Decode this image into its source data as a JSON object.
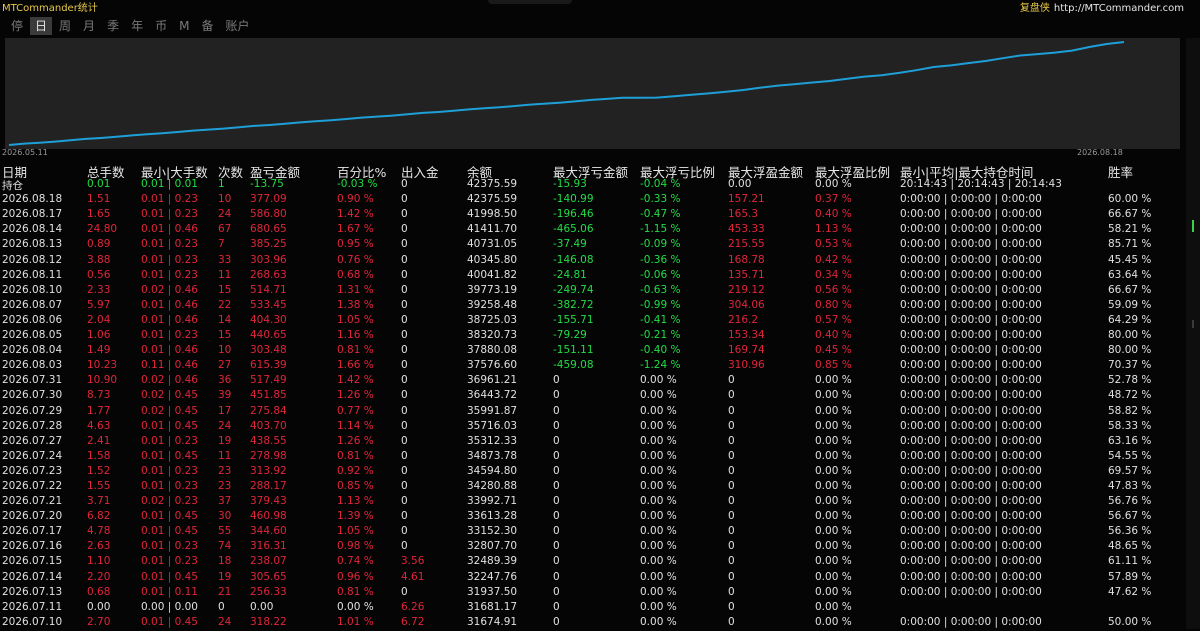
{
  "app": {
    "title": "MTCommander统计",
    "right_name": "复盘侠",
    "right_url": "http://MTCommander.com"
  },
  "tabs": [
    "停",
    "日",
    "周",
    "月",
    "季",
    "年",
    "币",
    "M",
    "备",
    "账户"
  ],
  "active_tab": "日",
  "chart_data": {
    "type": "line",
    "start_label": "2026.05.11",
    "end_label": "2026.08.18",
    "color": "#1e9fd8",
    "background": "#222222",
    "grid": false
  },
  "colors": {
    "profit": "#e0253a",
    "loss": "#22dd44",
    "text": "#e0e0e0",
    "accent": "#e8c84a"
  },
  "table": {
    "headers": [
      "日期",
      "总手数",
      "最小|大手数",
      "次数",
      "盈亏金额",
      "百分比%",
      "出入金",
      "余额",
      "最大浮亏金额",
      "最大浮亏比例",
      "最大浮盈金额",
      "最大浮盈比例",
      "最小|平均|最大持仓时间",
      "胜率"
    ],
    "rows": [
      [
        "持仓",
        "0.01",
        "0.01 | 0.01",
        "1",
        "-13.75",
        "-0.03 %",
        "0",
        "42375.59",
        "-15.93",
        "-0.04 %",
        "0.00",
        "0.00 %",
        "20:14:43 | 20:14:43 | 20:14:43",
        ""
      ],
      [
        "2026.08.18",
        "1.51",
        "0.01 | 0.23",
        "10",
        "377.09",
        "0.90 %",
        "0",
        "42375.59",
        "-140.99",
        "-0.33 %",
        "157.21",
        "0.37 %",
        "0:00:00 | 0:00:00 | 0:00:00",
        "60.00 %"
      ],
      [
        "2026.08.17",
        "1.65",
        "0.01 | 0.23",
        "24",
        "586.80",
        "1.42 %",
        "0",
        "41998.50",
        "-196.46",
        "-0.47 %",
        "165.3",
        "0.40 %",
        "0:00:00 | 0:00:00 | 0:00:00",
        "66.67 %"
      ],
      [
        "2026.08.14",
        "24.80",
        "0.01 | 0.46",
        "67",
        "680.65",
        "1.67 %",
        "0",
        "41411.70",
        "-465.06",
        "-1.15 %",
        "453.33",
        "1.13 %",
        "0:00:00 | 0:00:00 | 0:00:00",
        "58.21 %"
      ],
      [
        "2026.08.13",
        "0.89",
        "0.01 | 0.23",
        "7",
        "385.25",
        "0.95 %",
        "0",
        "40731.05",
        "-37.49",
        "-0.09 %",
        "215.55",
        "0.53 %",
        "0:00:00 | 0:00:00 | 0:00:00",
        "85.71 %"
      ],
      [
        "2026.08.12",
        "3.88",
        "0.01 | 0.23",
        "33",
        "303.96",
        "0.76 %",
        "0",
        "40345.80",
        "-146.08",
        "-0.36 %",
        "168.78",
        "0.42 %",
        "0:00:00 | 0:00:00 | 0:00:00",
        "45.45 %"
      ],
      [
        "2026.08.11",
        "0.56",
        "0.01 | 0.23",
        "11",
        "268.63",
        "0.68 %",
        "0",
        "40041.82",
        "-24.81",
        "-0.06 %",
        "135.71",
        "0.34 %",
        "0:00:00 | 0:00:00 | 0:00:00",
        "63.64 %"
      ],
      [
        "2026.08.10",
        "2.33",
        "0.02 | 0.46",
        "15",
        "514.71",
        "1.31 %",
        "0",
        "39773.19",
        "-249.74",
        "-0.63 %",
        "219.12",
        "0.56 %",
        "0:00:00 | 0:00:00 | 0:00:00",
        "66.67 %"
      ],
      [
        "2026.08.07",
        "5.97",
        "0.01 | 0.46",
        "22",
        "533.45",
        "1.38 %",
        "0",
        "39258.48",
        "-382.72",
        "-0.99 %",
        "304.06",
        "0.80 %",
        "0:00:00 | 0:00:00 | 0:00:00",
        "59.09 %"
      ],
      [
        "2026.08.06",
        "2.04",
        "0.01 | 0.46",
        "14",
        "404.30",
        "1.05 %",
        "0",
        "38725.03",
        "-155.71",
        "-0.41 %",
        "216.2",
        "0.57 %",
        "0:00:00 | 0:00:00 | 0:00:00",
        "64.29 %"
      ],
      [
        "2026.08.05",
        "1.06",
        "0.01 | 0.23",
        "15",
        "440.65",
        "1.16 %",
        "0",
        "38320.73",
        "-79.29",
        "-0.21 %",
        "153.34",
        "0.40 %",
        "0:00:00 | 0:00:00 | 0:00:00",
        "80.00 %"
      ],
      [
        "2026.08.04",
        "1.49",
        "0.01 | 0.46",
        "10",
        "303.48",
        "0.81 %",
        "0",
        "37880.08",
        "-151.11",
        "-0.40 %",
        "169.74",
        "0.45 %",
        "0:00:00 | 0:00:00 | 0:00:00",
        "80.00 %"
      ],
      [
        "2026.08.03",
        "10.23",
        "0.11 | 0.46",
        "27",
        "615.39",
        "1.66 %",
        "0",
        "37576.60",
        "-459.08",
        "-1.24 %",
        "310.96",
        "0.85 %",
        "0:00:00 | 0:00:00 | 0:00:00",
        "70.37 %"
      ],
      [
        "2026.07.31",
        "10.90",
        "0.02 | 0.46",
        "36",
        "517.49",
        "1.42 %",
        "0",
        "36961.21",
        "0",
        "0.00 %",
        "0",
        "0.00 %",
        "0:00:00 | 0:00:00 | 0:00:00",
        "52.78 %"
      ],
      [
        "2026.07.30",
        "8.73",
        "0.02 | 0.45",
        "39",
        "451.85",
        "1.26 %",
        "0",
        "36443.72",
        "0",
        "0.00 %",
        "0",
        "0.00 %",
        "0:00:00 | 0:00:00 | 0:00:00",
        "48.72 %"
      ],
      [
        "2026.07.29",
        "1.77",
        "0.02 | 0.45",
        "17",
        "275.84",
        "0.77 %",
        "0",
        "35991.87",
        "0",
        "0.00 %",
        "0",
        "0.00 %",
        "0:00:00 | 0:00:00 | 0:00:00",
        "58.82 %"
      ],
      [
        "2026.07.28",
        "4.63",
        "0.01 | 0.45",
        "24",
        "403.70",
        "1.14 %",
        "0",
        "35716.03",
        "0",
        "0.00 %",
        "0",
        "0.00 %",
        "0:00:00 | 0:00:00 | 0:00:00",
        "58.33 %"
      ],
      [
        "2026.07.27",
        "2.41",
        "0.01 | 0.23",
        "19",
        "438.55",
        "1.26 %",
        "0",
        "35312.33",
        "0",
        "0.00 %",
        "0",
        "0.00 %",
        "0:00:00 | 0:00:00 | 0:00:00",
        "63.16 %"
      ],
      [
        "2026.07.24",
        "1.58",
        "0.01 | 0.45",
        "11",
        "278.98",
        "0.81 %",
        "0",
        "34873.78",
        "0",
        "0.00 %",
        "0",
        "0.00 %",
        "0:00:00 | 0:00:00 | 0:00:00",
        "54.55 %"
      ],
      [
        "2026.07.23",
        "1.52",
        "0.01 | 0.23",
        "23",
        "313.92",
        "0.92 %",
        "0",
        "34594.80",
        "0",
        "0.00 %",
        "0",
        "0.00 %",
        "0:00:00 | 0:00:00 | 0:00:00",
        "69.57 %"
      ],
      [
        "2026.07.22",
        "1.55",
        "0.01 | 0.23",
        "23",
        "288.17",
        "0.85 %",
        "0",
        "34280.88",
        "0",
        "0.00 %",
        "0",
        "0.00 %",
        "0:00:00 | 0:00:00 | 0:00:00",
        "47.83 %"
      ],
      [
        "2026.07.21",
        "3.71",
        "0.02 | 0.23",
        "37",
        "379.43",
        "1.13 %",
        "0",
        "33992.71",
        "0",
        "0.00 %",
        "0",
        "0.00 %",
        "0:00:00 | 0:00:00 | 0:00:00",
        "56.76 %"
      ],
      [
        "2026.07.20",
        "6.82",
        "0.01 | 0.45",
        "30",
        "460.98",
        "1.39 %",
        "0",
        "33613.28",
        "0",
        "0.00 %",
        "0",
        "0.00 %",
        "0:00:00 | 0:00:00 | 0:00:00",
        "56.67 %"
      ],
      [
        "2026.07.17",
        "4.78",
        "0.01 | 0.45",
        "55",
        "344.60",
        "1.05 %",
        "0",
        "33152.30",
        "0",
        "0.00 %",
        "0",
        "0.00 %",
        "0:00:00 | 0:00:00 | 0:00:00",
        "56.36 %"
      ],
      [
        "2026.07.16",
        "2.63",
        "0.01 | 0.23",
        "74",
        "316.31",
        "0.98 %",
        "0",
        "32807.70",
        "0",
        "0.00 %",
        "0",
        "0.00 %",
        "0:00:00 | 0:00:00 | 0:00:00",
        "48.65 %"
      ],
      [
        "2026.07.15",
        "1.10",
        "0.01 | 0.23",
        "18",
        "238.07",
        "0.74 %",
        "3.56",
        "32489.39",
        "0",
        "0.00 %",
        "0",
        "0.00 %",
        "0:00:00 | 0:00:00 | 0:00:00",
        "61.11 %"
      ],
      [
        "2026.07.14",
        "2.20",
        "0.01 | 0.45",
        "19",
        "305.65",
        "0.96 %",
        "4.61",
        "32247.76",
        "0",
        "0.00 %",
        "0",
        "0.00 %",
        "0:00:00 | 0:00:00 | 0:00:00",
        "57.89 %"
      ],
      [
        "2026.07.13",
        "0.68",
        "0.01 | 0.11",
        "21",
        "256.33",
        "0.81 %",
        "0",
        "31937.50",
        "0",
        "0.00 %",
        "0",
        "0.00 %",
        "0:00:00 | 0:00:00 | 0:00:00",
        "47.62 %"
      ],
      [
        "2026.07.11",
        "0.00",
        "0.00 | 0.00",
        "0",
        "0.00",
        "0.00 %",
        "6.26",
        "31681.17",
        "0",
        "0.00 %",
        "0",
        "0.00 %",
        "",
        ""
      ],
      [
        "2026.07.10",
        "2.70",
        "0.01 | 0.45",
        "24",
        "318.22",
        "1.01 %",
        "6.72",
        "31674.91",
        "0",
        "0.00 %",
        "0",
        "0.00 %",
        "0:00:00 | 0:00:00 | 0:00:00",
        "50.00 %"
      ]
    ]
  }
}
